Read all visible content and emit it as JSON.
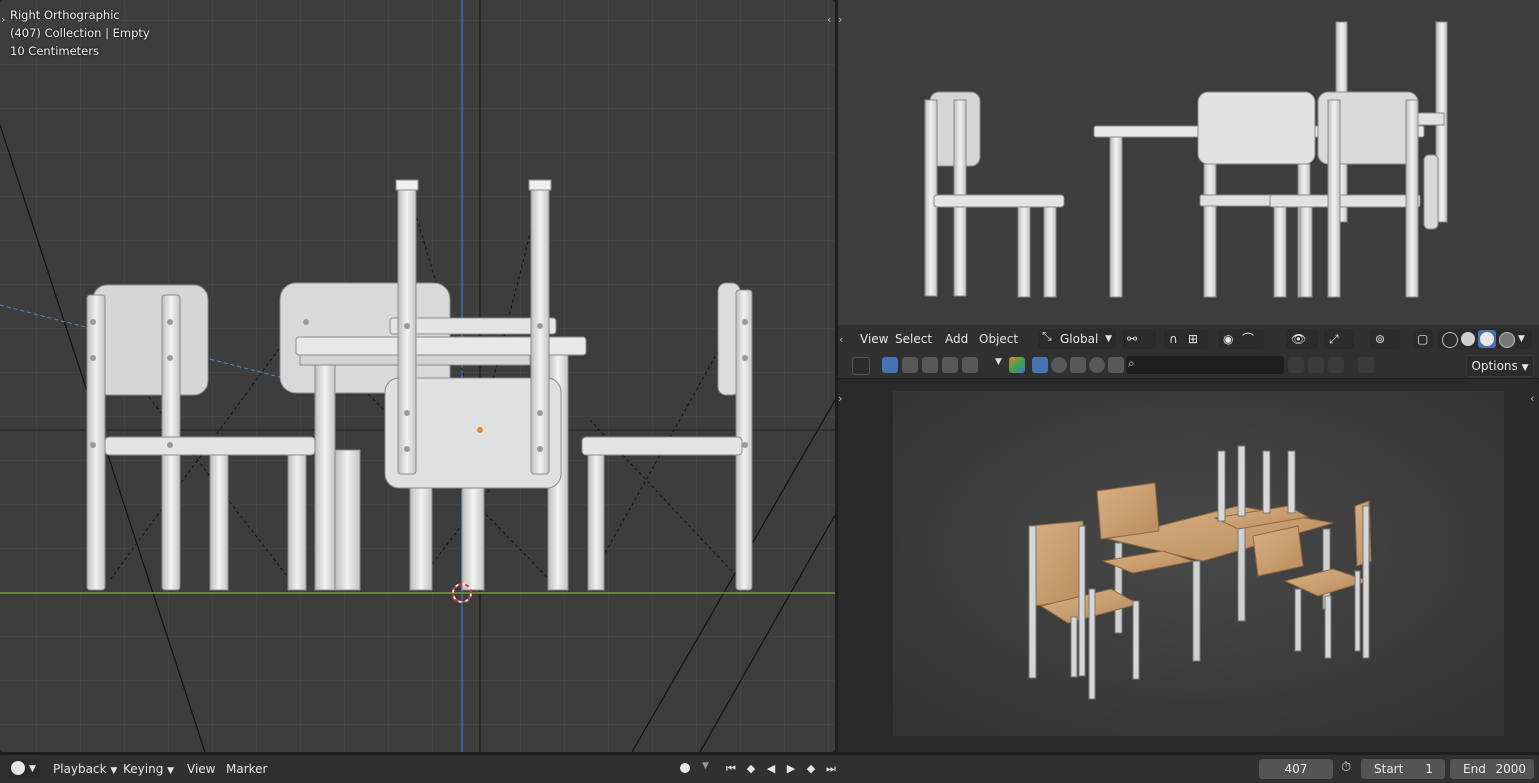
{
  "viewport_left": {
    "view_name": "Right Orthographic",
    "collection_info": "(407) Collection | Empty",
    "scale": "10 Centimeters"
  },
  "header": {
    "menu_view": "View",
    "menu_select": "Select",
    "menu_add": "Add",
    "menu_object": "Object",
    "transform_orientation": "Global"
  },
  "toolbar": {
    "options_label": "Options",
    "search_placeholder": ""
  },
  "timeline": {
    "menu_playback": "Playback",
    "menu_keying": "Keying",
    "menu_view": "View",
    "menu_marker": "Marker",
    "current_frame": "407",
    "start_label": "Start",
    "start_value": "1",
    "end_label": "End",
    "end_value": "2000"
  },
  "colors": {
    "viewport_bg": "#3d3d3d",
    "header_bg": "#303030",
    "accent_blue": "#4772b3",
    "axis_green": "#6d9a3f",
    "axis_blue": "#3a5f9e",
    "wood": "#c9a071"
  }
}
